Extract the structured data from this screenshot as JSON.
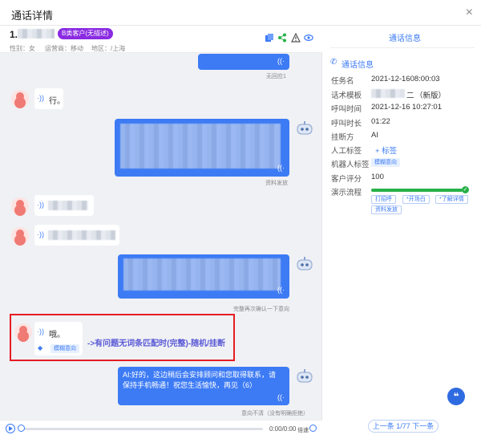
{
  "window": {
    "title": "通话详情",
    "close_icon": "×"
  },
  "customer": {
    "phone_prefix": "1.",
    "badge": "B类客户(无描述)",
    "gender": "性别：女",
    "operator": "运营商：移动",
    "region": "地区：/上海"
  },
  "chat": {
    "no_reply_label": "无回应1",
    "msg_user_1": "行。",
    "bot_tag_1": "资料发放",
    "bot_tag_2": "完整再次确认一下意向",
    "user_last_text": "哦。",
    "user_last_tag": "模糊意向",
    "annotation": "->有问题无词条匹配时(完整)-随机/挂断",
    "bot_final": "AI:好的，这边稍后会安排顾问和您取得联系，请保持手机畅通！祝您生活愉快，再见（6）",
    "bot_final_tag": "意向不清（没有明确拒绝）"
  },
  "player": {
    "time": "0:00/0:00",
    "speed": "倍速"
  },
  "details": {
    "tab": "通话信息",
    "section": "通话信息",
    "rows": [
      {
        "label": "任务名",
        "value": "2021-12-1608:00:03"
      },
      {
        "label": "话术模板",
        "value": "（新版）",
        "value_prefix": "二"
      },
      {
        "label": "呼叫时间",
        "value": "10:27:01",
        "value_prefix": "2021-12-16"
      },
      {
        "label": "呼叫时长",
        "value": "01:22"
      },
      {
        "label": "挂断方",
        "value": "AI"
      },
      {
        "label": "人工标签",
        "value": "+ 标签"
      },
      {
        "label": "机器人标签",
        "value": "模糊意向"
      },
      {
        "label": "客户评分",
        "value": "100"
      },
      {
        "label": "演示流程",
        "value": ""
      }
    ],
    "flow_progress": 1.0,
    "flow_chips": [
      "打招呼",
      "*开场白",
      "*了解详情",
      "资料发放"
    ]
  },
  "pager": {
    "text": "上一条 1/77 下一条"
  },
  "fab_icon": "❝",
  "colors": {
    "accent": "#3d7bf5",
    "badge": "#8a2be2",
    "success": "#27b148",
    "highlight": "#e51c23"
  }
}
